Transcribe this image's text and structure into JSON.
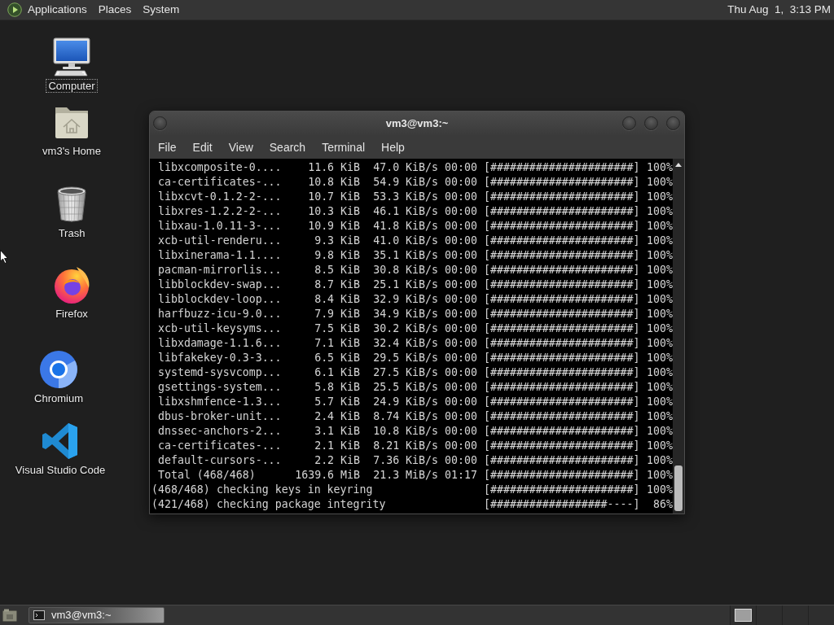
{
  "top_panel": {
    "menus": [
      "Applications",
      "Places",
      "System"
    ],
    "clock": "Thu Aug  1,  3:13 PM"
  },
  "desktop_icons": [
    {
      "kind": "computer",
      "label": "Computer",
      "selected": true
    },
    {
      "kind": "home",
      "label": "vm3's Home",
      "selected": false
    },
    {
      "kind": "trash",
      "label": "Trash",
      "selected": false
    },
    {
      "kind": "firefox",
      "label": "Firefox",
      "selected": false
    },
    {
      "kind": "chromium",
      "label": "Chromium",
      "selected": false
    },
    {
      "kind": "vscode",
      "label": "Visual Studio Code",
      "selected": false
    }
  ],
  "terminal_window": {
    "title": "vm3@vm3:~",
    "menu": [
      "File",
      "Edit",
      "View",
      "Search",
      "Terminal",
      "Help"
    ],
    "lines": [
      {
        "kind": "download",
        "name": "libxcomposite-0....",
        "size": "11.6 KiB",
        "rate": "47.0 KiB/s",
        "eta": "00:00",
        "bar": "[######################]",
        "percent": "100%"
      },
      {
        "kind": "download",
        "name": "ca-certificates-...",
        "size": "10.8 KiB",
        "rate": "54.9 KiB/s",
        "eta": "00:00",
        "bar": "[######################]",
        "percent": "100%"
      },
      {
        "kind": "download",
        "name": "libxcvt-0.1.2-2-...",
        "size": "10.7 KiB",
        "rate": "53.3 KiB/s",
        "eta": "00:00",
        "bar": "[######################]",
        "percent": "100%"
      },
      {
        "kind": "download",
        "name": "libxres-1.2.2-2-...",
        "size": "10.3 KiB",
        "rate": "46.1 KiB/s",
        "eta": "00:00",
        "bar": "[######################]",
        "percent": "100%"
      },
      {
        "kind": "download",
        "name": "libxau-1.0.11-3-...",
        "size": "10.9 KiB",
        "rate": "41.8 KiB/s",
        "eta": "00:00",
        "bar": "[######################]",
        "percent": "100%"
      },
      {
        "kind": "download",
        "name": "xcb-util-renderu...",
        "size": "9.3 KiB",
        "rate": "41.0 KiB/s",
        "eta": "00:00",
        "bar": "[######################]",
        "percent": "100%"
      },
      {
        "kind": "download",
        "name": "libxinerama-1.1....",
        "size": "9.8 KiB",
        "rate": "35.1 KiB/s",
        "eta": "00:00",
        "bar": "[######################]",
        "percent": "100%"
      },
      {
        "kind": "download",
        "name": "pacman-mirrorlis...",
        "size": "8.5 KiB",
        "rate": "30.8 KiB/s",
        "eta": "00:00",
        "bar": "[######################]",
        "percent": "100%"
      },
      {
        "kind": "download",
        "name": "libblockdev-swap...",
        "size": "8.7 KiB",
        "rate": "25.1 KiB/s",
        "eta": "00:00",
        "bar": "[######################]",
        "percent": "100%"
      },
      {
        "kind": "download",
        "name": "libblockdev-loop...",
        "size": "8.4 KiB",
        "rate": "32.9 KiB/s",
        "eta": "00:00",
        "bar": "[######################]",
        "percent": "100%"
      },
      {
        "kind": "download",
        "name": "harfbuzz-icu-9.0...",
        "size": "7.9 KiB",
        "rate": "34.9 KiB/s",
        "eta": "00:00",
        "bar": "[######################]",
        "percent": "100%"
      },
      {
        "kind": "download",
        "name": "xcb-util-keysyms...",
        "size": "7.5 KiB",
        "rate": "30.2 KiB/s",
        "eta": "00:00",
        "bar": "[######################]",
        "percent": "100%"
      },
      {
        "kind": "download",
        "name": "libxdamage-1.1.6...",
        "size": "7.1 KiB",
        "rate": "32.4 KiB/s",
        "eta": "00:00",
        "bar": "[######################]",
        "percent": "100%"
      },
      {
        "kind": "download",
        "name": "libfakekey-0.3-3...",
        "size": "6.5 KiB",
        "rate": "29.5 KiB/s",
        "eta": "00:00",
        "bar": "[######################]",
        "percent": "100%"
      },
      {
        "kind": "download",
        "name": "systemd-sysvcomp...",
        "size": "6.1 KiB",
        "rate": "27.5 KiB/s",
        "eta": "00:00",
        "bar": "[######################]",
        "percent": "100%"
      },
      {
        "kind": "download",
        "name": "gsettings-system...",
        "size": "5.8 KiB",
        "rate": "25.5 KiB/s",
        "eta": "00:00",
        "bar": "[######################]",
        "percent": "100%"
      },
      {
        "kind": "download",
        "name": "libxshmfence-1.3...",
        "size": "5.7 KiB",
        "rate": "24.9 KiB/s",
        "eta": "00:00",
        "bar": "[######################]",
        "percent": "100%"
      },
      {
        "kind": "download",
        "name": "dbus-broker-unit...",
        "size": "2.4 KiB",
        "rate": "8.74 KiB/s",
        "eta": "00:00",
        "bar": "[######################]",
        "percent": "100%"
      },
      {
        "kind": "download",
        "name": "dnssec-anchors-2...",
        "size": "3.1 KiB",
        "rate": "10.8 KiB/s",
        "eta": "00:00",
        "bar": "[######################]",
        "percent": "100%"
      },
      {
        "kind": "download",
        "name": "ca-certificates-...",
        "size": "2.1 KiB",
        "rate": "8.21 KiB/s",
        "eta": "00:00",
        "bar": "[######################]",
        "percent": "100%"
      },
      {
        "kind": "download",
        "name": "default-cursors-...",
        "size": "2.2 KiB",
        "rate": "7.36 KiB/s",
        "eta": "00:00",
        "bar": "[######################]",
        "percent": "100%"
      },
      {
        "kind": "total",
        "name": "Total (468/468)",
        "size": "1639.6 MiB",
        "rate": "21.3 MiB/s",
        "eta": "01:17",
        "bar": "[######################]",
        "percent": "100%"
      },
      {
        "kind": "check",
        "count": "(468/468)",
        "message": "checking keys in keyring",
        "bar": "[######################]",
        "percent": "100%"
      },
      {
        "kind": "check",
        "count": "(421/468)",
        "message": "checking package integrity",
        "bar": "[##################----]",
        "percent": "86%"
      }
    ]
  },
  "taskbar": {
    "tasks": [
      {
        "title": "vm3@vm3:~",
        "selected": true
      }
    ]
  }
}
